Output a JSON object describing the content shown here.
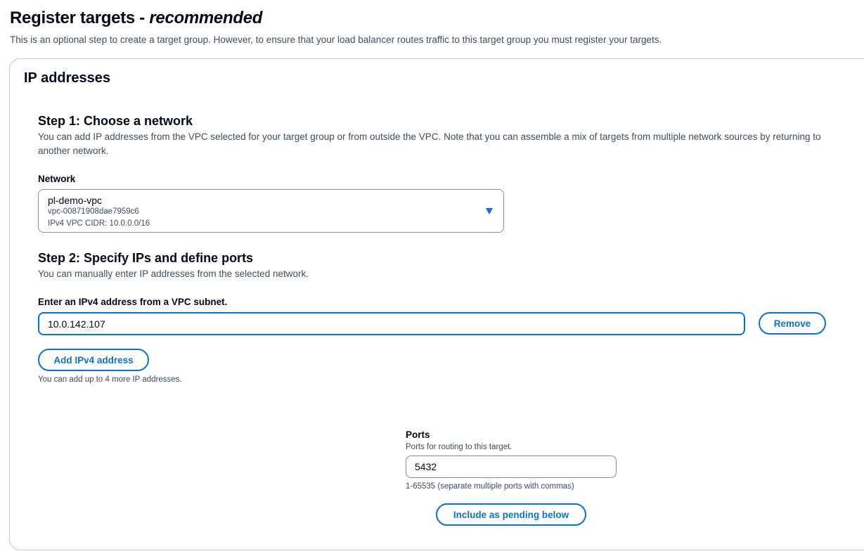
{
  "header": {
    "title_main": "Register targets - ",
    "title_em": "recommended",
    "description": "This is an optional step to create a target group. However, to ensure that your load balancer routes traffic to this target group you must register your targets."
  },
  "container": {
    "title": "IP addresses"
  },
  "step1": {
    "heading": "Step 1: Choose a network",
    "description_line1": "You can add IP addresses from the VPC selected for your target group or from outside the VPC. Note that you can assemble a mix of targets from multiple network sources by returning to",
    "description_line2": "another network.",
    "network_label": "Network",
    "network": {
      "name": "pl-demo-vpc",
      "vpc_id": "vpc-00871908dae7959c6",
      "cidr": "IPv4 VPC CIDR: 10.0.0.0/16"
    }
  },
  "step2": {
    "heading": "Step 2: Specify IPs and define ports",
    "description": "You can manually enter IP addresses from the selected network.",
    "ip_label": "Enter an IPv4 address from a VPC subnet.",
    "ip_value": "10.0.142.107",
    "remove_label": "Remove",
    "add_label": "Add IPv4 address",
    "add_hint": "You can add up to 4 more IP addresses."
  },
  "ports": {
    "label": "Ports",
    "description": "Ports for routing to this target.",
    "value": "5432",
    "constraint": "1-65535 (separate multiple ports with commas)",
    "include_label": "Include as pending below"
  },
  "colors": {
    "accent": "#0972d3",
    "text": "#000716",
    "secondary_text": "#414d5c",
    "border": "#c6c6cd"
  },
  "icons": {
    "network_dropdown": "caret-down-icon"
  }
}
